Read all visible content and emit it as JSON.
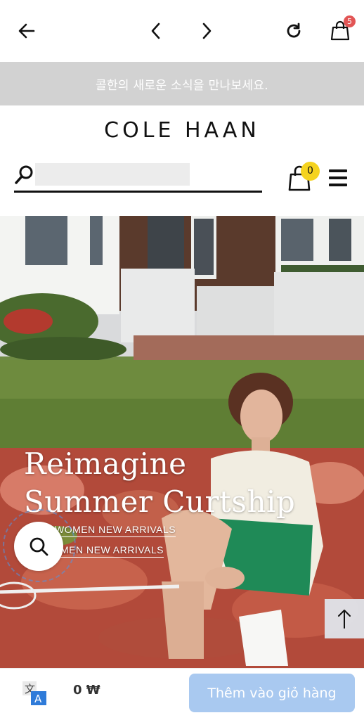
{
  "toolbar": {
    "back_icon": "arrow-left-icon",
    "prev_icon": "chevron-left-icon",
    "next_icon": "chevron-right-icon",
    "reload_icon": "reload-icon",
    "bag_icon": "shopping-bag-icon",
    "bag_badge": "5"
  },
  "notice": {
    "text": "콜한의 새로운 소식을 만나보세요."
  },
  "header": {
    "logo": "COLE HAAN",
    "search_placeholder": "",
    "cart_count": "0"
  },
  "hero": {
    "title_line1": "Reimagine",
    "title_line2": "Summer Curtship",
    "links": {
      "women": "WOMEN NEW ARRIVALS",
      "men": "MEN NEW ARRIVALS"
    }
  },
  "bottom": {
    "price": "0 ₩",
    "add_to_cart": "Thêm vào giỏ hàng"
  },
  "colors": {
    "notice_bg": "#d2d2d2",
    "cart_badge": "#f5d31f",
    "toolbar_badge": "#e25555",
    "add_to_cart_bg": "#a9c9f0"
  }
}
